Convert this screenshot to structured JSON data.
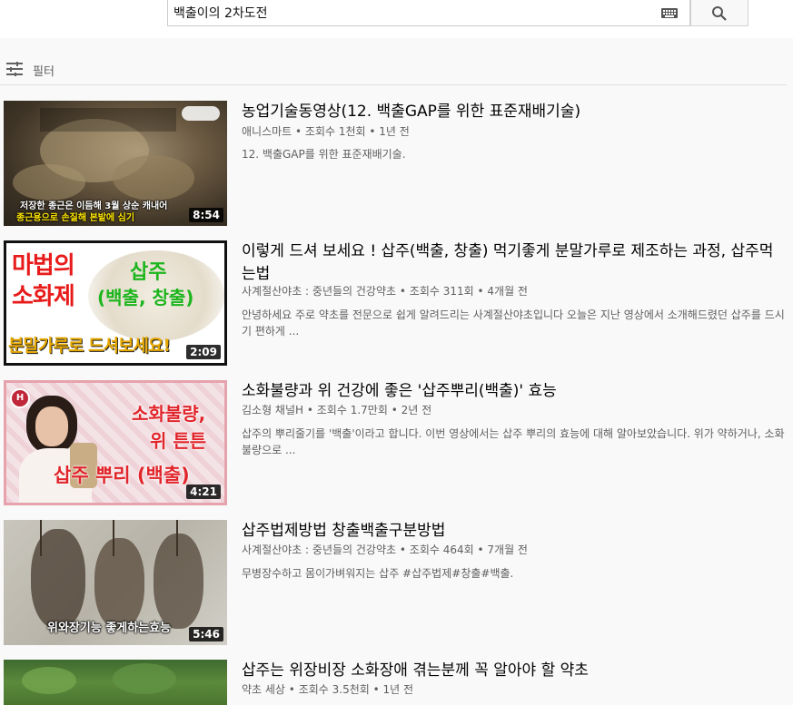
{
  "search": {
    "query": "백출이의 2차도전"
  },
  "filter": {
    "label": "필터"
  },
  "results": [
    {
      "title": "농업기술동영상(12. 백출GAP를 위한 표준재배기술)",
      "channel": "애니스마트",
      "views": "조회수 1천회",
      "age": "1년 전",
      "description": "12. 백출GAP를 위한 표준재배기술.",
      "duration": "8:54",
      "overlay": [
        "저장한 종근은 이듬해 3월 상순 캐내어",
        "종근용으로 손질해 본밭에 심기"
      ]
    },
    {
      "title": "이렇게 드셔 보세요 ! 삽주(백출, 창출) 먹기좋게 분말가루로 제조하는 과정, 삽주먹는법",
      "channel": "사계절산야초 : 중년들의 건강약초",
      "views": "조회수 311회",
      "age": "4개월 전",
      "description": "안녕하세요 주로 약초를 전문으로 쉽게 알려드리는 사계절산야초입니다 오늘은 지난 영상에서 소개해드렸던 삽주를 드시기 편하게 ...",
      "duration": "2:09",
      "overlay": [
        "마법의",
        "소화제",
        "삽주",
        "(백출, 창출)",
        "분말가루로 드셔보세요!"
      ]
    },
    {
      "title": "소화불량과 위 건강에 좋은 '삽주뿌리(백출)' 효능",
      "channel": "김소형 채널H",
      "views": "조회수 1.7만회",
      "age": "2년 전",
      "description": "삽주의 뿌리줄기를 '백출'이라고 합니다. 이번 영상에서는 삽주 뿌리의 효능에 대해 알아보았습니다. 위가 약하거나, 소화불량으로 ...",
      "duration": "4:21",
      "overlay": [
        "소화불량,",
        "위 튼튼",
        "삽주 뿌리 (백출)"
      ]
    },
    {
      "title": "삽주법제방법 창출백출구분방법",
      "channel": "사계절산야초 : 중년들의 건강약초",
      "views": "조회수 464회",
      "age": "7개월 전",
      "description": "무병장수하고 몸이가벼워지는 삽주 #삽주법제#창출#백출.",
      "duration": "5:46",
      "overlay": [
        "위와장기능 좋게하는효능"
      ]
    },
    {
      "title": "삽주는 위장비장 소화장애 겪는분께 꼭 알아야 할 약초",
      "channel": "약초 세상",
      "views": "조회수 3.5천회",
      "age": "1년 전",
      "description": "",
      "duration": "",
      "overlay": []
    }
  ]
}
